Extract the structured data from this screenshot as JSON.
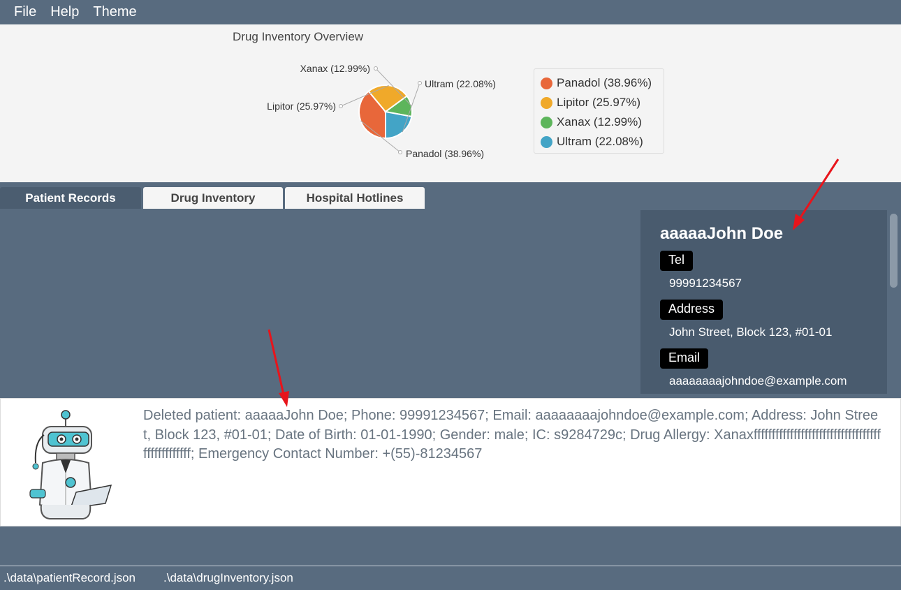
{
  "menu": {
    "file": "File",
    "help": "Help",
    "theme": "Theme"
  },
  "chart_data": {
    "type": "pie",
    "title": "Drug Inventory Overview",
    "labels": [
      "Panadol (38.96%)",
      "Lipitor (25.97%)",
      "Xanax (12.99%)",
      "Ultram (22.08%)"
    ],
    "values": [
      38.96,
      25.97,
      12.99,
      22.08
    ],
    "colors": [
      "#e8673a",
      "#f0a92a",
      "#5db55b",
      "#43a4c6"
    ],
    "legend_position": "right"
  },
  "tabs": [
    "Patient Records",
    "Drug Inventory",
    "Hospital Hotlines"
  ],
  "patient": {
    "name": "aaaaaJohn Doe",
    "tel_label": "Tel",
    "tel": "99991234567",
    "address_label": "Address",
    "address": "John Street, Block 123, #01-01",
    "email_label": "Email",
    "email": "aaaaaaaajohndoe@example.com"
  },
  "result": {
    "message": "Deleted patient: aaaaaJohn Doe; Phone: 99991234567; Email: aaaaaaaajohndoe@example.com; Address: John Street, Block 123, #01-01; Date of Birth: 01-01-1990; Gender: male; IC: s9284729c; Drug Allergy: Xanaxffffffffffffffffffffffffffffffffffffffffffffffff; Emergency Contact Number: +(55)-81234567"
  },
  "status": {
    "patient_file": ".\\data\\patientRecord.json",
    "drug_file": ".\\data\\drugInventory.json"
  },
  "colors": {
    "accent": "#586b7f",
    "card": "#495b6e",
    "annotation": "#e8141b"
  }
}
